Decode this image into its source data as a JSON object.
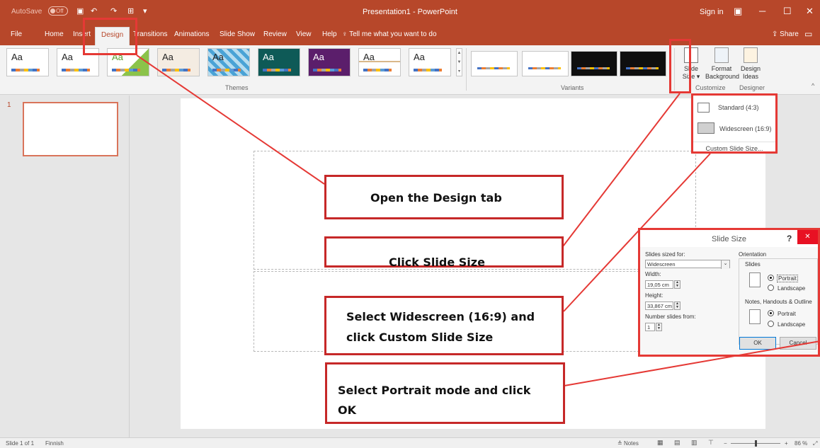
{
  "titlebar": {
    "autosave_label": "AutoSave",
    "autosave_state": "Off",
    "save_icon": "save-icon",
    "undo_icon": "undo-icon",
    "redo_icon": "redo-icon",
    "window_title": "Presentation1 - PowerPoint",
    "sign_in": "Sign in",
    "display_options_icon": "▣",
    "minimize": "─",
    "restore": "☐",
    "close": "✕"
  },
  "tabs": [
    "File",
    "Home",
    "Insert",
    "Design",
    "Transitions",
    "Animations",
    "Slide Show",
    "Review",
    "View",
    "Help"
  ],
  "tell_me": "Tell me what you want to do",
  "share": "Share",
  "ribbon": {
    "theme_label": "Aa",
    "themes_group": "Themes",
    "variants_group": "Variants",
    "slide_size_btn": "Slide Size",
    "format_background_btn": "Format Background",
    "design_ideas_btn": "Design Ideas",
    "customize_group": "Customize",
    "designer_group": "Designer"
  },
  "slides_panel": {
    "slide_number": "1"
  },
  "slide_size_menu": {
    "standard": "Standard (4:3)",
    "widescreen": "Widescreen (16:9)",
    "custom": "Custom Slide Size..."
  },
  "dialog": {
    "title": "Slide Size",
    "help": "?",
    "close": "✕",
    "sized_for_label": "Slides sized for:",
    "sized_for_value": "Widescreen",
    "width_label": "Width:",
    "width_value": "19,05 cm",
    "height_label": "Height:",
    "height_value": "33,867 cm",
    "number_from_label": "Number slides from:",
    "number_from_value": "1",
    "orientation_label": "Orientation",
    "slides_label": "Slides",
    "portrait": "Portrait",
    "landscape": "Landscape",
    "notes_label": "Notes, Handouts & Outline",
    "ok": "OK",
    "cancel": "Cancel"
  },
  "callouts": {
    "step1": "Open the Design tab",
    "step2": "Click Slide Size",
    "step3_line1": "Select Widescreen (16:9) and",
    "step3_line2": "click Custom Slide Size",
    "step4_line1": "Select Portrait mode and click",
    "step4_line2": "OK"
  },
  "statusbar": {
    "slide_info": "Slide 1 of 1",
    "language": "Finnish",
    "notes": "Notes",
    "zoom": "86 %"
  },
  "colors": {
    "accent": "#b7472a",
    "callout_red": "#c62828",
    "close_red": "#e81123"
  }
}
